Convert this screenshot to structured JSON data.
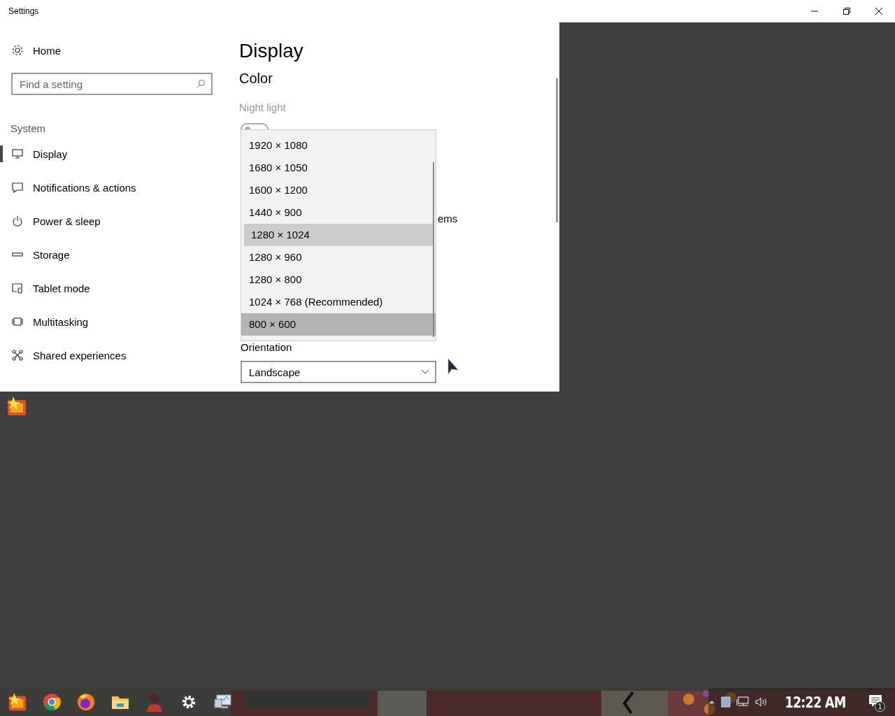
{
  "window": {
    "title": "Settings"
  },
  "sidebar": {
    "home": "Home",
    "search": {
      "placeholder": "Find a setting"
    },
    "section": "System",
    "items": [
      {
        "label": "Display",
        "selected": true
      },
      {
        "label": "Notifications & actions",
        "selected": false
      },
      {
        "label": "Power & sleep",
        "selected": false
      },
      {
        "label": "Storage",
        "selected": false
      },
      {
        "label": "Tablet mode",
        "selected": false
      },
      {
        "label": "Multitasking",
        "selected": false
      },
      {
        "label": "Shared experiences",
        "selected": false
      }
    ]
  },
  "content": {
    "title": "Display",
    "section": "Color",
    "night_light": {
      "label": "Night light",
      "on": false
    },
    "covered_text": "ems",
    "orientation": {
      "label": "Orientation",
      "value": "Landscape"
    }
  },
  "resolution_dropdown": {
    "options": [
      {
        "label": "1920 × 1080",
        "selected": false,
        "hovered": false
      },
      {
        "label": "1680 × 1050",
        "selected": false,
        "hovered": false
      },
      {
        "label": "1600 × 1200",
        "selected": false,
        "hovered": false
      },
      {
        "label": "1440 × 900",
        "selected": false,
        "hovered": false
      },
      {
        "label": "1280 × 1024",
        "selected": true,
        "hovered": false
      },
      {
        "label": "1280 × 960",
        "selected": false,
        "hovered": false
      },
      {
        "label": "1280 × 800",
        "selected": false,
        "hovered": false
      },
      {
        "label": "1024 × 768 (Recommended)",
        "selected": false,
        "hovered": false
      },
      {
        "label": "800 × 600",
        "selected": false,
        "hovered": true
      }
    ]
  },
  "taskbar": {
    "clock": "12:22 AM",
    "notification_count": "1"
  }
}
